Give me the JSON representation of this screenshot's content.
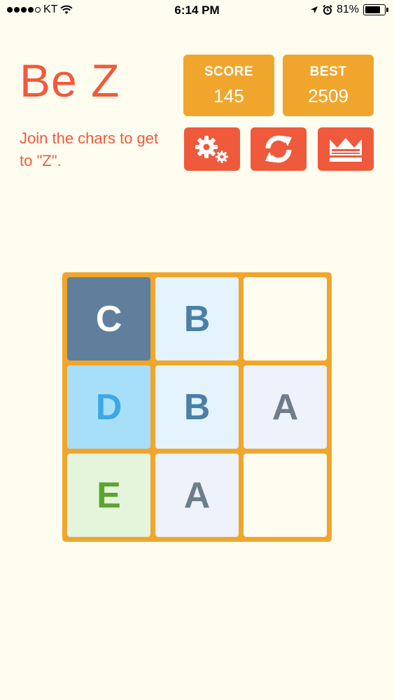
{
  "status": {
    "carrier": "KT",
    "time": "6:14 PM",
    "battery": "81%",
    "battery_level": 0.81
  },
  "header": {
    "title": "Be Z",
    "subtitle": "Join the chars to get to \"Z\"."
  },
  "score": {
    "label": "SCORE",
    "value": "145"
  },
  "best": {
    "label": "BEST",
    "value": "2509"
  },
  "buttons": [
    {
      "name": "settings-button",
      "icon": "gears-icon"
    },
    {
      "name": "restart-button",
      "icon": "refresh-icon"
    },
    {
      "name": "leaderboard-button",
      "icon": "crown-icon"
    }
  ],
  "board": {
    "rows": [
      [
        "C",
        "B",
        ""
      ],
      [
        "D",
        "B",
        "A"
      ],
      [
        "E",
        "A",
        ""
      ]
    ]
  },
  "colors": {
    "background": "#fffdf0",
    "accent": "#ef5a3c",
    "orange": "#f0a62d",
    "tile_empty": "#fffdf0",
    "tile_A": "#eef2fb",
    "tile_B": "#e4f3fc",
    "tile_C": "#5f7f9c",
    "tile_D": "#a8dff8",
    "tile_E": "#e5f5dc"
  }
}
